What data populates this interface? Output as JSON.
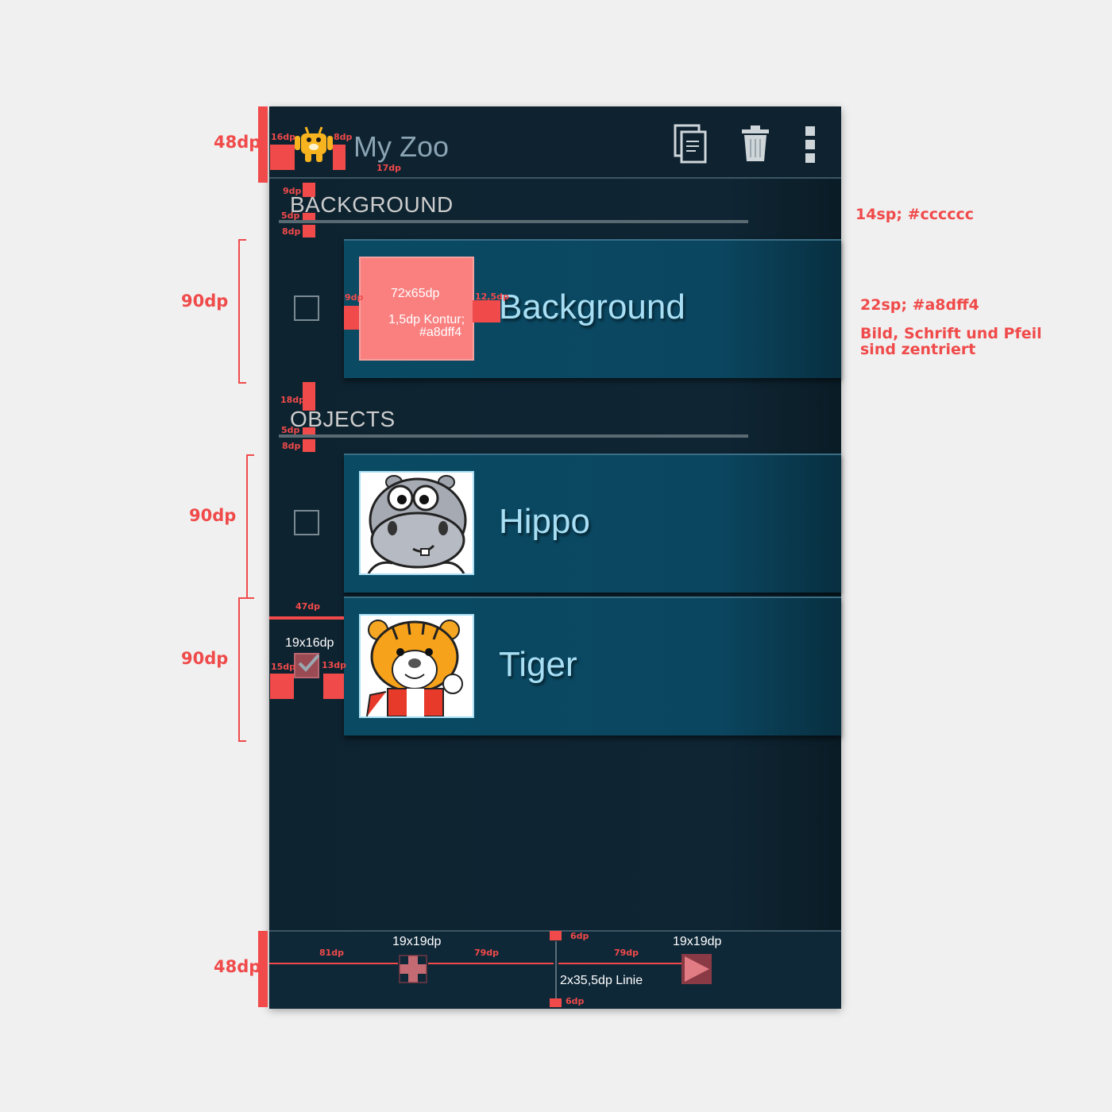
{
  "app": {
    "title": "My Zoo"
  },
  "toolbar": {
    "copy_icon": "copy-icon",
    "delete_icon": "trash-icon",
    "overflow_icon": "more-vert-icon"
  },
  "sections": {
    "background": {
      "title": "BACKGROUND"
    },
    "objects": {
      "title": "OBJECTS"
    }
  },
  "items": [
    {
      "label": "Background",
      "checked": false
    },
    {
      "label": "Hippo",
      "checked": false
    },
    {
      "label": "Tiger",
      "checked": true
    }
  ],
  "bottombar": {
    "add_icon": "plus-icon",
    "play_icon": "play-icon"
  },
  "annotations": {
    "actionbar_height": "48dp",
    "bottombar_height": "48dp",
    "row1_height": "90dp",
    "row2_height": "90dp",
    "row3_height": "90dp",
    "icon_left": "16dp",
    "icon_right": "8dp",
    "title_gap": "17dp",
    "bg_top": "9dp",
    "bg_line_gap": "5dp",
    "bg_line_bottom": "8dp",
    "obj_top": "18dp",
    "obj_line_gap": "5dp",
    "obj_line_bottom": "8dp",
    "thumb_left": "9dp",
    "thumb_right": "12,5dp",
    "thumb_size": "72x65dp",
    "thumb_border": "1,5dp Kontur;",
    "thumb_border_color": "#a8dff4",
    "section_font": "14sp; #cccccc",
    "item_font": "22sp; #a8dff4",
    "centered_note_1": "Bild, Schrift und Pfeil",
    "centered_note_2": "sind zentriert",
    "checkbox_col": "47dp",
    "checkbox_size": "19x16dp",
    "checkbox_left": "15dp",
    "checkbox_right": "13dp",
    "bb_left": "81dp",
    "bb_mid_left": "79dp",
    "bb_mid_right": "79dp",
    "bb_plus_size": "19x19dp",
    "bb_play_size": "19x19dp",
    "bb_top": "6dp",
    "bb_bottom": "6dp",
    "bb_divider": "2x35,5dp Linie"
  },
  "colors": {
    "accent": "#a8dff4",
    "section": "#cccccc",
    "annotation": "#f04a4a"
  }
}
